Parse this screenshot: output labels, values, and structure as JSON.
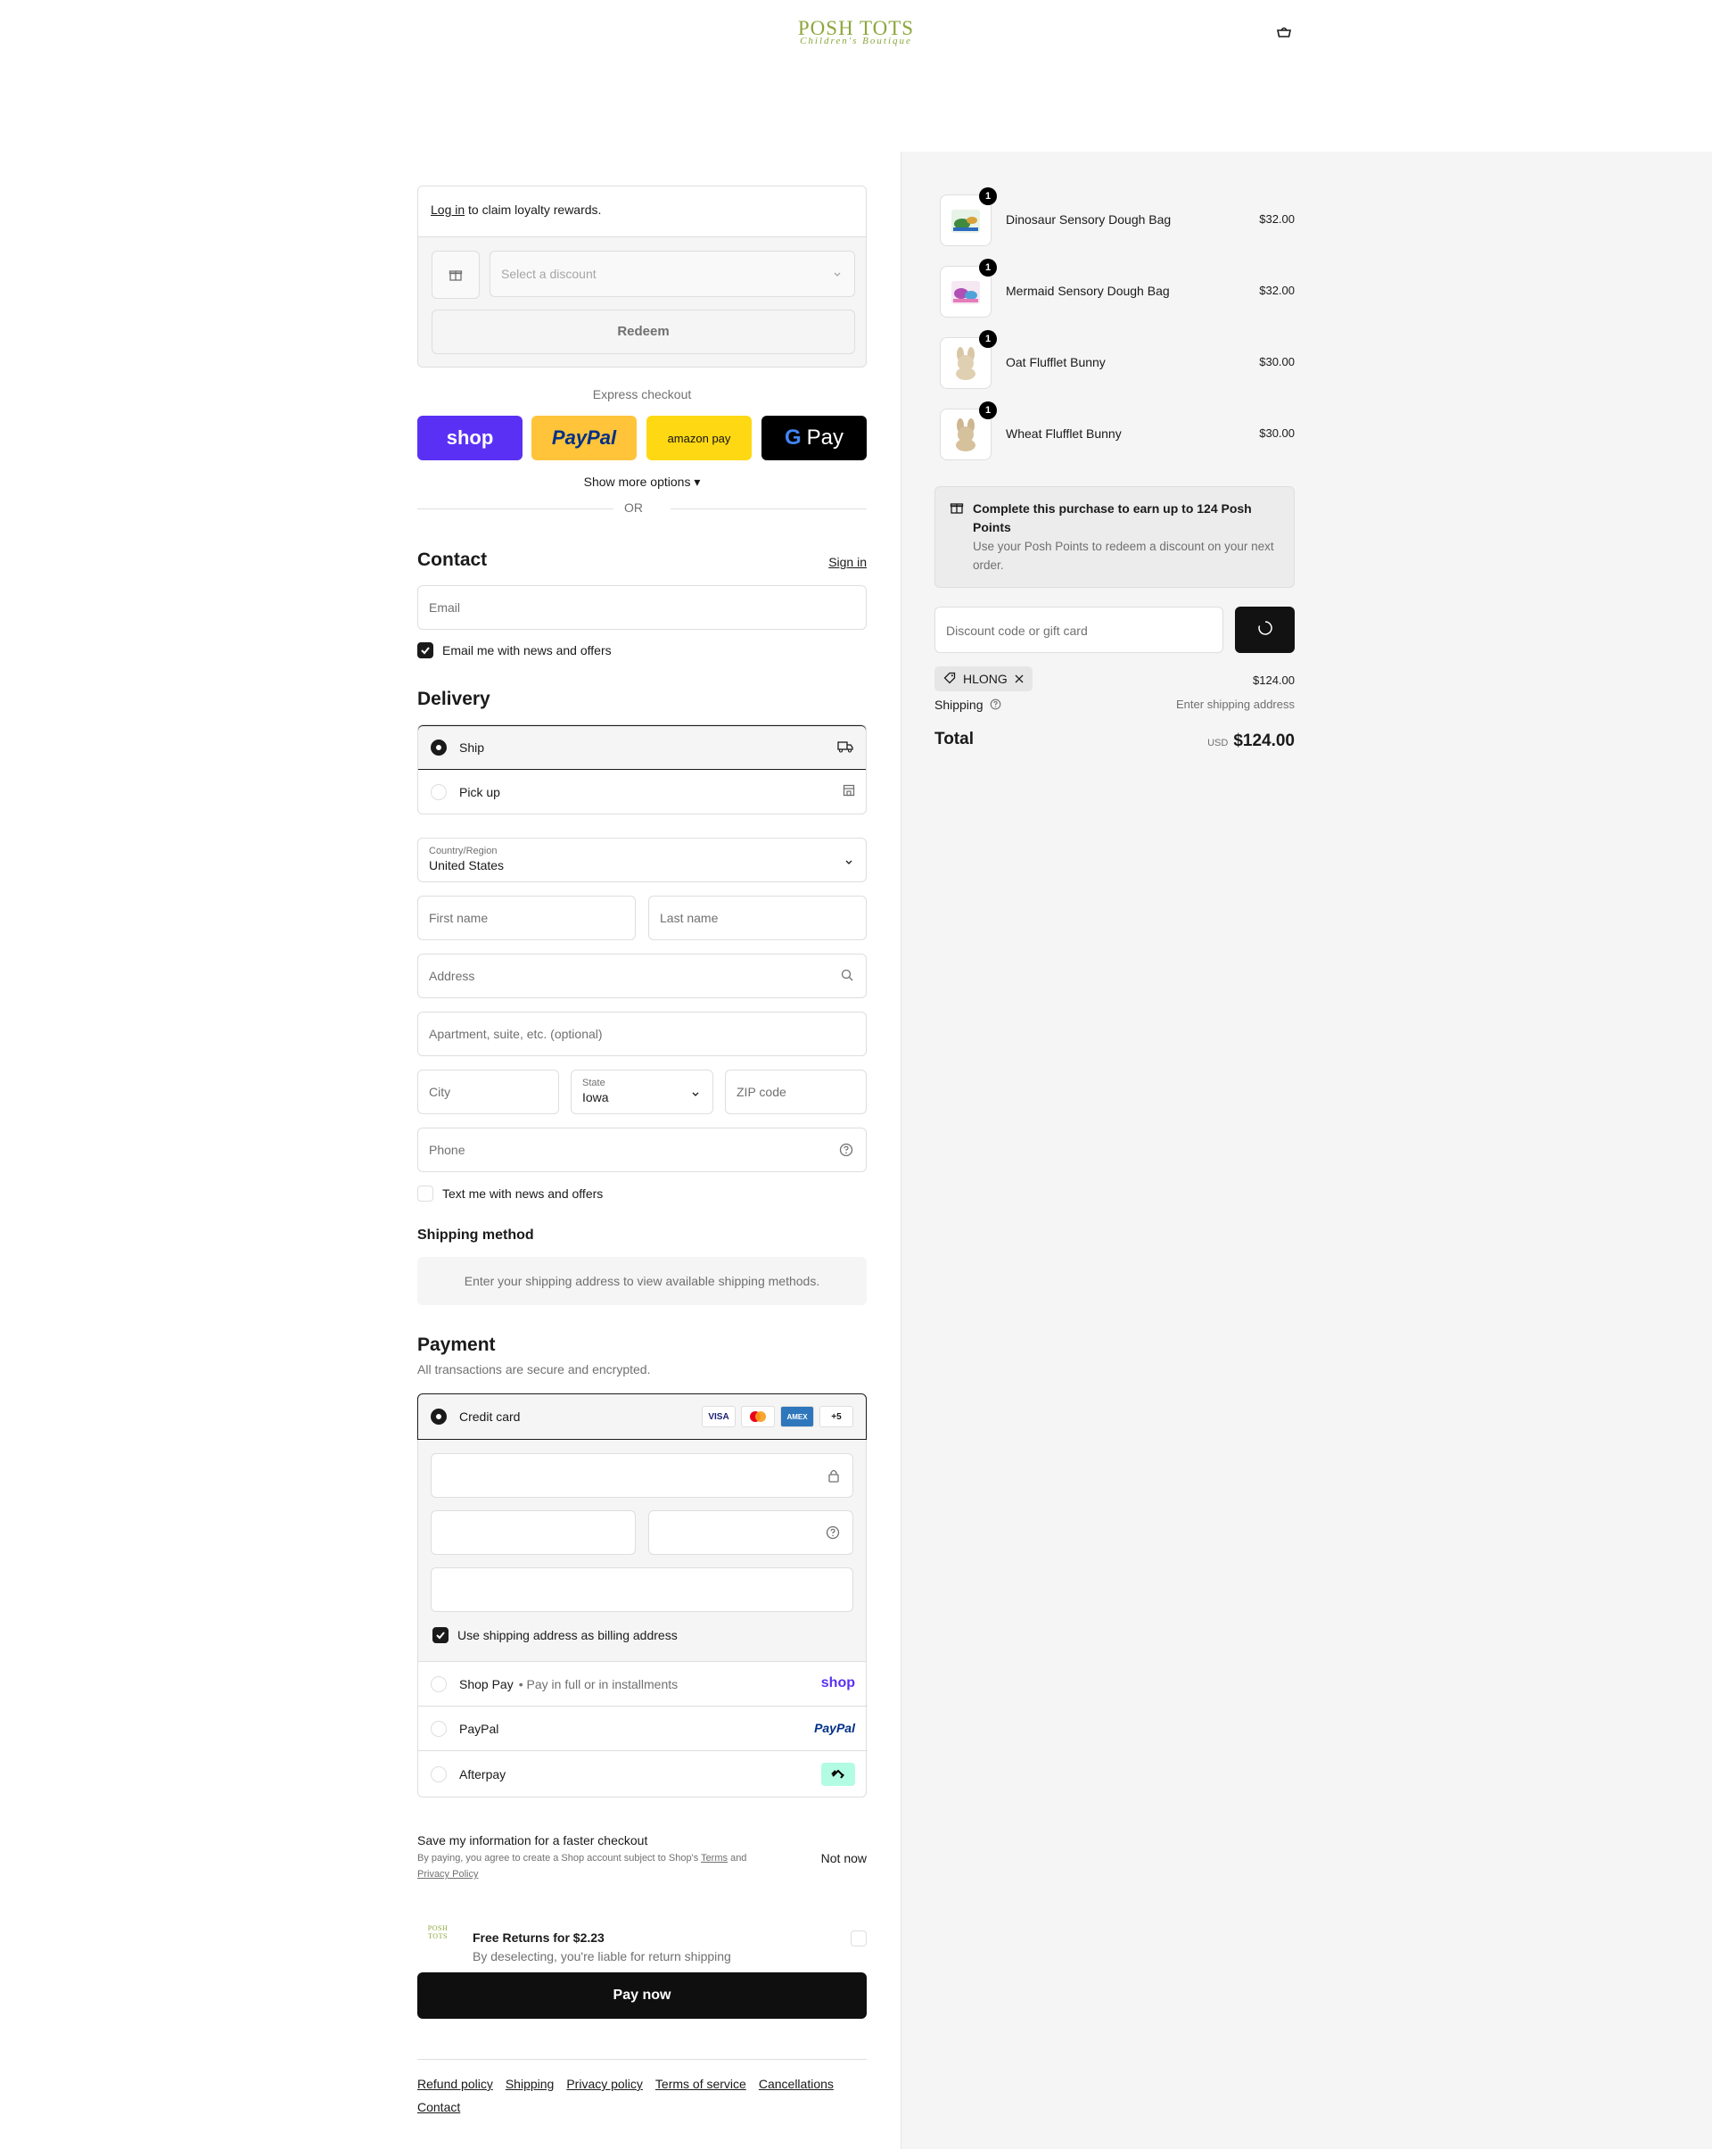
{
  "header": {
    "logo_main": "POSH TOTS",
    "logo_sub": "Children's Boutique",
    "cart_icon": "bag-icon"
  },
  "loyalty": {
    "login_link": "Log in",
    "login_text": " to claim loyalty rewards.",
    "discount_placeholder": "Select a discount",
    "redeem": "Redeem"
  },
  "express": {
    "label": "Express checkout",
    "shop": "shop",
    "paypal": "PayPal",
    "amazon": "amazon pay",
    "gpay": "Pay",
    "show_more": "Show more options",
    "or": "OR"
  },
  "contact": {
    "title": "Contact",
    "sign_in": "Sign in",
    "email_placeholder": "Email",
    "news_label": "Email me with news and offers",
    "news_checked": true
  },
  "delivery": {
    "title": "Delivery",
    "ship": "Ship",
    "pickup": "Pick up",
    "country_label": "Country/Region",
    "country_value": "United States",
    "first_name": "First name",
    "last_name": "Last name",
    "address": "Address",
    "apartment": "Apartment, suite, etc. (optional)",
    "city": "City",
    "state_label": "State",
    "state_value": "Iowa",
    "zip": "ZIP code",
    "phone": "Phone",
    "text_label": "Text me with news and offers"
  },
  "shipping_method": {
    "title": "Shipping method",
    "message": "Enter your shipping address to view available shipping methods."
  },
  "payment": {
    "title": "Payment",
    "subtitle": "All transactions are secure and encrypted.",
    "credit_card": "Credit card",
    "brands": [
      "VISA",
      "MC",
      "AMEX",
      "+5"
    ],
    "billing_label": "Use shipping address as billing address",
    "shop_pay": "Shop Pay",
    "shop_pay_note": "Pay in full or in installments",
    "shop_logo": "shop",
    "paypal": "PayPal",
    "paypal_logo": "PayPal",
    "afterpay": "Afterpay"
  },
  "save_info": {
    "title": "Save my information for a faster checkout",
    "legal_prefix": "By paying, you agree to create a Shop account subject to Shop's ",
    "terms": "Terms",
    "and": " and ",
    "privacy": "Privacy Policy",
    "not_now": "Not now"
  },
  "returns": {
    "logo": "POSH TOTS",
    "title": "Free Returns for $2.23",
    "subtitle": "By deselecting, you're liable for return shipping"
  },
  "pay_now": "Pay now",
  "footer": [
    "Refund policy",
    "Shipping",
    "Privacy policy",
    "Terms of service",
    "Cancellations",
    "Contact"
  ],
  "order": {
    "items": [
      {
        "qty": "1",
        "name": "Dinosaur Sensory Dough Bag",
        "price": "$32.00"
      },
      {
        "qty": "1",
        "name": "Mermaid Sensory Dough Bag",
        "price": "$32.00"
      },
      {
        "qty": "1",
        "name": "Oat Flufflet Bunny",
        "price": "$30.00"
      },
      {
        "qty": "1",
        "name": "Wheat Flufflet Bunny",
        "price": "$30.00"
      }
    ],
    "points_title": "Complete this purchase to earn up to 124 Posh Points",
    "points_sub": "Use your Posh Points to redeem a discount on your next order.",
    "discount_placeholder": "Discount code or gift card",
    "tag": "HLONG",
    "subtotal": "$124.00",
    "shipping_label": "Shipping",
    "shipping_value": "Enter shipping address",
    "total_label": "Total",
    "currency": "USD",
    "total": "$124.00"
  }
}
